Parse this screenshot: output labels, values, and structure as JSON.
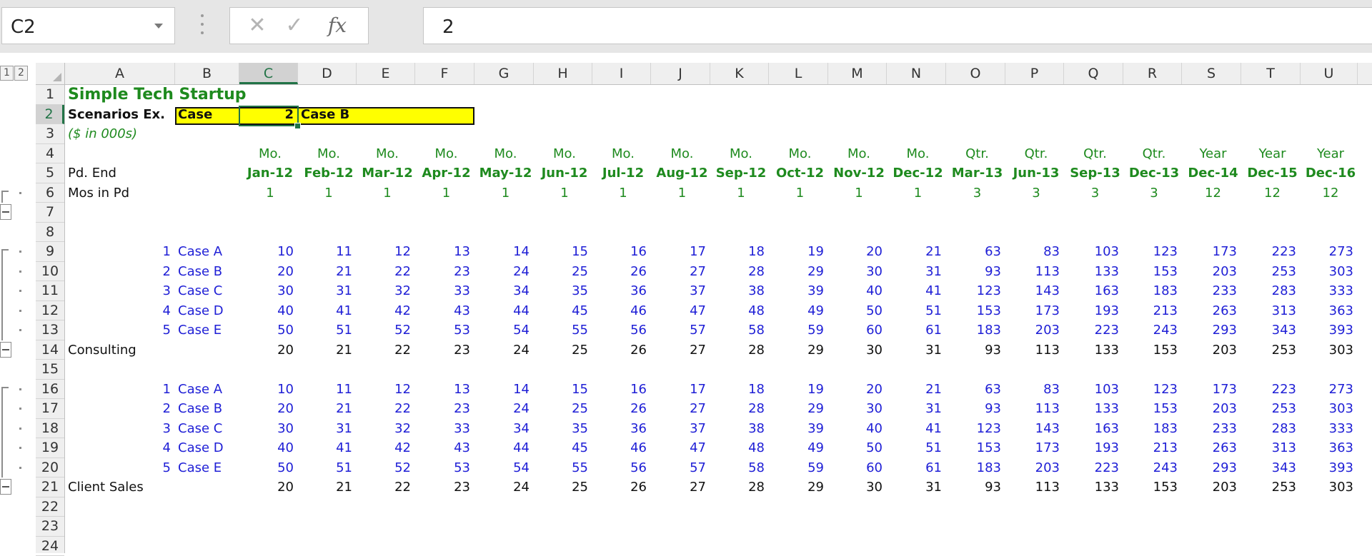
{
  "namebox": "C2",
  "formula": "2",
  "formula_buttons": {
    "cancel": "✕",
    "enter": "✓",
    "fx": "fx"
  },
  "outline_levels": [
    "1",
    "2"
  ],
  "selected_column": "C",
  "selected_row": 2,
  "columns": [
    "A",
    "B",
    "C",
    "D",
    "E",
    "F",
    "G",
    "H",
    "I",
    "J",
    "K",
    "L",
    "M",
    "N",
    "O",
    "P",
    "Q",
    "R",
    "S",
    "T",
    "U"
  ],
  "rows": [
    1,
    2,
    3,
    4,
    5,
    6,
    7,
    8,
    9,
    10,
    11,
    12,
    13,
    14,
    15,
    16,
    17,
    18,
    19,
    20,
    21,
    22,
    23,
    24
  ],
  "title": "Simple Tech Startup",
  "scenario": {
    "label": "Scenarios Ex.",
    "case_label": "Case",
    "case_value": "2",
    "case_name": "Case B"
  },
  "units_note": "($ in 000s)",
  "row_labels": {
    "pd_end": "Pd. End",
    "mos_in_pd": "Mos in Pd",
    "consulting": "Consulting",
    "client_sales": "Client Sales"
  },
  "period_types": [
    "Mo.",
    "Mo.",
    "Mo.",
    "Mo.",
    "Mo.",
    "Mo.",
    "Mo.",
    "Mo.",
    "Mo.",
    "Mo.",
    "Mo.",
    "Mo.",
    "Qtr.",
    "Qtr.",
    "Qtr.",
    "Qtr.",
    "Year",
    "Year",
    "Year"
  ],
  "period_ends": [
    "Jan-12",
    "Feb-12",
    "Mar-12",
    "Apr-12",
    "May-12",
    "Jun-12",
    "Jul-12",
    "Aug-12",
    "Sep-12",
    "Oct-12",
    "Nov-12",
    "Dec-12",
    "Mar-13",
    "Jun-13",
    "Sep-13",
    "Dec-13",
    "Dec-14",
    "Dec-15",
    "Dec-16"
  ],
  "months_in_period": [
    "1",
    "1",
    "1",
    "1",
    "1",
    "1",
    "1",
    "1",
    "1",
    "1",
    "1",
    "1",
    "3",
    "3",
    "3",
    "3",
    "12",
    "12",
    "12"
  ],
  "cases": [
    {
      "num": "1",
      "name": "Case A",
      "values": [
        "10",
        "11",
        "12",
        "13",
        "14",
        "15",
        "16",
        "17",
        "18",
        "19",
        "20",
        "21",
        "63",
        "83",
        "103",
        "123",
        "173",
        "223",
        "273"
      ]
    },
    {
      "num": "2",
      "name": "Case B",
      "values": [
        "20",
        "21",
        "22",
        "23",
        "24",
        "25",
        "26",
        "27",
        "28",
        "29",
        "30",
        "31",
        "93",
        "113",
        "133",
        "153",
        "203",
        "253",
        "303"
      ]
    },
    {
      "num": "3",
      "name": "Case C",
      "values": [
        "30",
        "31",
        "32",
        "33",
        "34",
        "35",
        "36",
        "37",
        "38",
        "39",
        "40",
        "41",
        "123",
        "143",
        "163",
        "183",
        "233",
        "283",
        "333"
      ]
    },
    {
      "num": "4",
      "name": "Case D",
      "values": [
        "40",
        "41",
        "42",
        "43",
        "44",
        "45",
        "46",
        "47",
        "48",
        "49",
        "50",
        "51",
        "153",
        "173",
        "193",
        "213",
        "263",
        "313",
        "363"
      ]
    },
    {
      "num": "5",
      "name": "Case E",
      "values": [
        "50",
        "51",
        "52",
        "53",
        "54",
        "55",
        "56",
        "57",
        "58",
        "59",
        "60",
        "61",
        "183",
        "203",
        "223",
        "243",
        "293",
        "343",
        "393"
      ]
    }
  ],
  "consulting_values": [
    "20",
    "21",
    "22",
    "23",
    "24",
    "25",
    "26",
    "27",
    "28",
    "29",
    "30",
    "31",
    "93",
    "113",
    "133",
    "153",
    "203",
    "253",
    "303"
  ],
  "client_sales_values": [
    "20",
    "21",
    "22",
    "23",
    "24",
    "25",
    "26",
    "27",
    "28",
    "29",
    "30",
    "31",
    "93",
    "113",
    "133",
    "153",
    "203",
    "253",
    "303"
  ]
}
